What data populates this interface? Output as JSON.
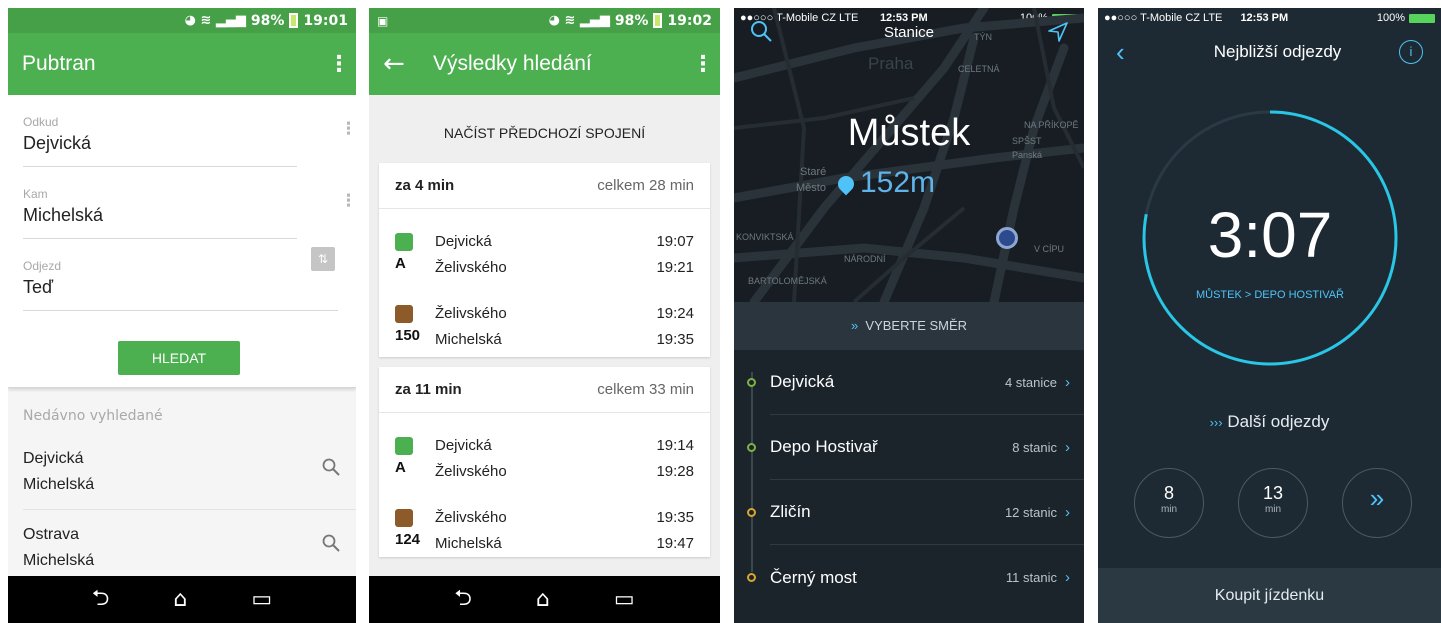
{
  "screen1": {
    "status": {
      "battery": "98%",
      "time": "19:01"
    },
    "app_title": "Pubtran",
    "from": {
      "label": "Odkud",
      "value": "Dejvická"
    },
    "to": {
      "label": "Kam",
      "value": "Michelská"
    },
    "depart": {
      "label": "Odjezd",
      "value": "Teď"
    },
    "search_label": "HLEDAT",
    "recent_header": "Nedávno vyhledané",
    "recent": [
      {
        "from": "Dejvická",
        "to": "Michelská"
      },
      {
        "from": "Ostrava",
        "to": "Michelská"
      }
    ],
    "icons": {
      "menu": "more-vert-icon",
      "swap": "swap-vertical-icon",
      "search": "search-icon"
    }
  },
  "screen2": {
    "status": {
      "battery": "98%",
      "time": "19:02"
    },
    "title": "Výsledky hledání",
    "load_previous": "NAČÍST PŘEDCHOZÍ SPOJENÍ",
    "results": [
      {
        "when": "za 4 min",
        "total": "celkem 28 min",
        "legs": [
          {
            "type": "metro",
            "line": "A",
            "from": "Dejvická",
            "to": "Želivského",
            "dep": "19:07",
            "arr": "19:21"
          },
          {
            "type": "bus",
            "line": "150",
            "from": "Želivského",
            "to": "Michelská",
            "dep": "19:24",
            "arr": "19:35"
          }
        ]
      },
      {
        "when": "za 11 min",
        "total": "celkem 33 min",
        "legs": [
          {
            "type": "metro",
            "line": "A",
            "from": "Dejvická",
            "to": "Želivského",
            "dep": "19:14",
            "arr": "19:28"
          },
          {
            "type": "bus",
            "line": "124",
            "from": "Želivského",
            "to": "Michelská",
            "dep": "19:35",
            "arr": "19:47"
          }
        ]
      }
    ]
  },
  "screen3": {
    "status": {
      "carrier": "●●○○○ T-Mobile CZ  LTE",
      "time": "12:53 PM",
      "battery": "100%"
    },
    "title": "Stanice",
    "stop": "Můstek",
    "distance": "152m",
    "map_labels": [
      "Praha",
      "Staré",
      "Město",
      "CELETNÁ",
      "NA PŘÍKOPĚ",
      "SPŠST",
      "Panská",
      "BARTOLOMĚJSKÁ",
      "NÁRODNÍ",
      "KONVIKTSKÁ",
      "V CÍPU",
      "TÝN"
    ],
    "choose": "VYBERTE SMĚR",
    "directions": [
      {
        "name": "Dejvická",
        "count": "4 stanice",
        "color": "#7cb342"
      },
      {
        "name": "Depo Hostivař",
        "count": "8 stanic",
        "color": "#7cb342"
      },
      {
        "name": "Zličín",
        "count": "12 stanic",
        "color": "#d8a630"
      },
      {
        "name": "Černý most",
        "count": "11 stanic",
        "color": "#d8a630"
      }
    ]
  },
  "screen4": {
    "status": {
      "carrier": "●●○○○ T-Mobile CZ  LTE",
      "time": "12:53 PM",
      "battery": "100%"
    },
    "title": "Nejbližší odjezdy",
    "countdown": "3:07",
    "route": "MŮSTEK > DEPO HOSTIVAŘ",
    "countdown_progress": 0.78,
    "next_label": "Další odjezdy",
    "next": [
      {
        "value": "8",
        "unit": "min"
      },
      {
        "value": "13",
        "unit": "min"
      }
    ],
    "buy_label": "Koupit jízdenku"
  },
  "colors": {
    "android_green": "#4caf50",
    "accent_blue": "#4fc3f7",
    "line_green": "#7cb342",
    "line_yellow": "#d8a630"
  }
}
